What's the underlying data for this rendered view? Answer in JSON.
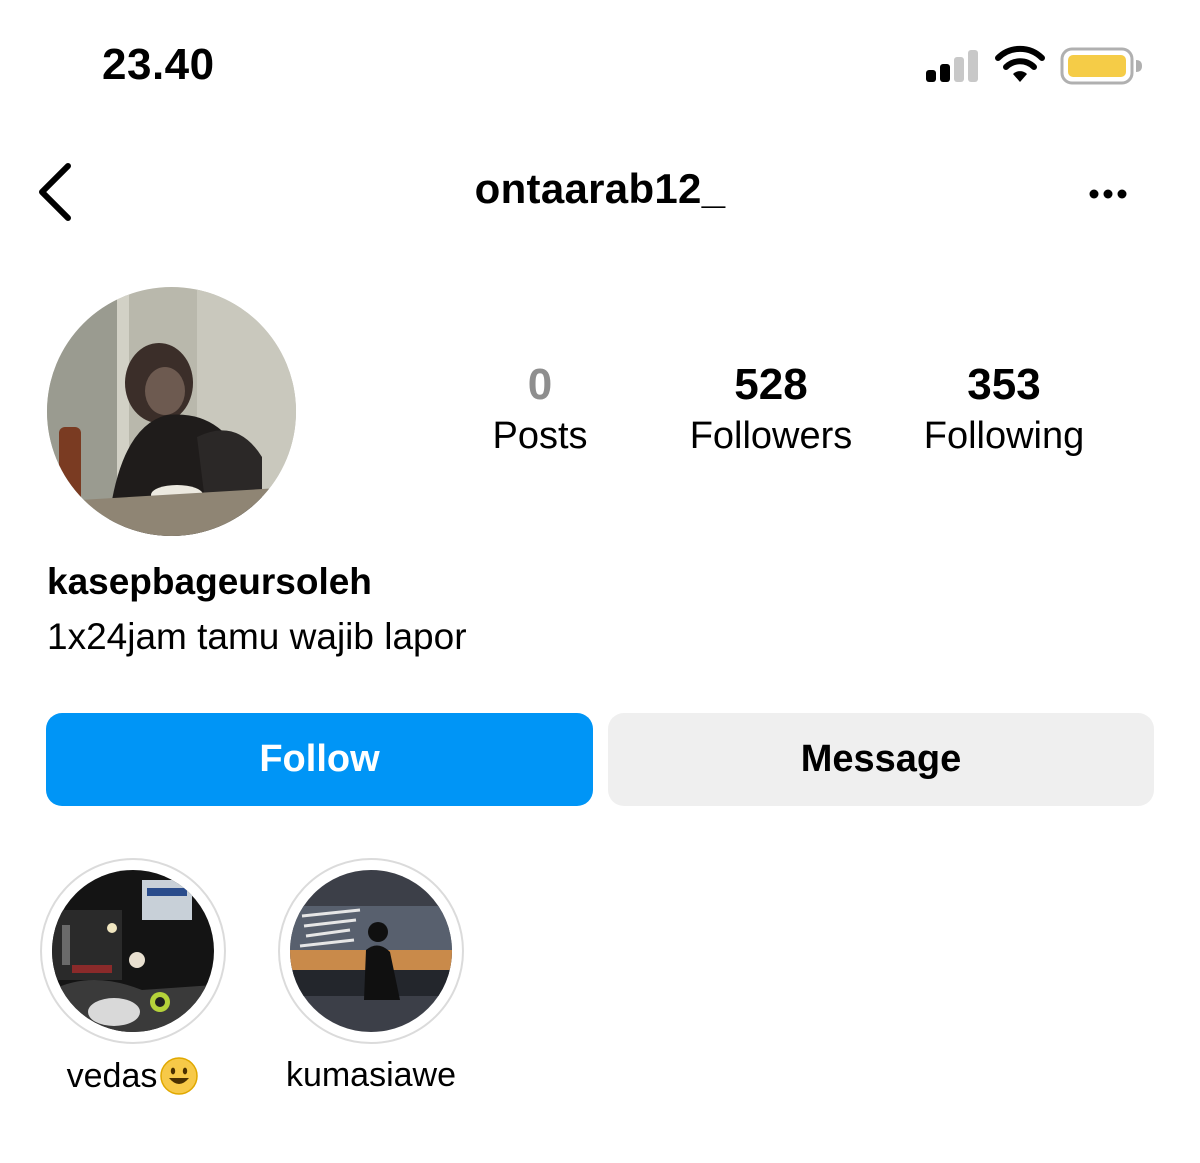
{
  "status_bar": {
    "time": "23.40",
    "signal_icon": "signal-bars-icon",
    "wifi_icon": "wifi-icon",
    "battery_icon": "battery-icon",
    "battery_color": "#f5cc47"
  },
  "header": {
    "back_icon": "chevron-left-icon",
    "username": "ontaarab12_",
    "more_icon": "more-horizontal-icon"
  },
  "profile": {
    "full_name": "kasepbageursoleh",
    "bio": "1x24jam tamu wajib lapor"
  },
  "stats": [
    {
      "count": "0",
      "label": "Posts"
    },
    {
      "count": "528",
      "label": "Followers"
    },
    {
      "count": "353",
      "label": "Following"
    }
  ],
  "actions": {
    "follow_label": "Follow",
    "message_label": "Message"
  },
  "highlights": [
    {
      "label": "vedas",
      "emoji_icon": "smiley-emoji-icon"
    },
    {
      "label": "kumasiawe"
    }
  ],
  "colors": {
    "accent": "#0095f6",
    "secondary_button": "#efefef",
    "muted_text": "#8e8e8e"
  }
}
